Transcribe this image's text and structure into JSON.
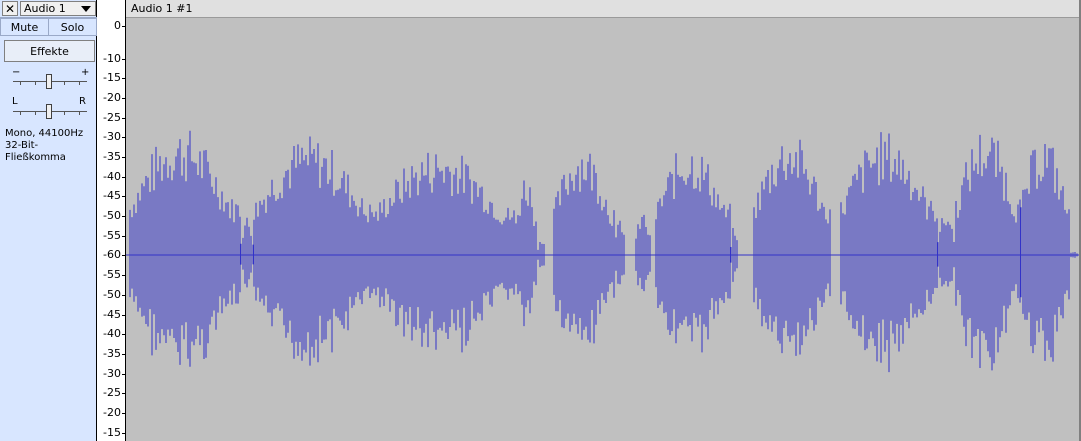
{
  "track": {
    "close_glyph": "✕",
    "name": "Audio 1",
    "mute_label": "Mute",
    "solo_label": "Solo",
    "effects_label": "Effekte",
    "gain_minus": "−",
    "gain_plus": "+",
    "pan_left": "L",
    "pan_right": "R",
    "format_line1": "Mono, 44100Hz",
    "format_line2": "32-Bit-Fließkomma"
  },
  "clip": {
    "name": "Audio 1 #1"
  },
  "ruler": {
    "labels": [
      "0",
      "-10",
      "-15",
      "-20",
      "-25",
      "-30",
      "-35",
      "-40",
      "-45",
      "-50",
      "-55",
      "-60",
      "-55",
      "-50",
      "-45",
      "-40",
      "-35",
      "-30",
      "-25",
      "-20",
      "-15"
    ]
  },
  "colors": {
    "waveform": "#3232c8",
    "rms": "#6464dc",
    "background": "#c0c0c0",
    "panel": "#d8e6ff"
  },
  "icons": {
    "close": "close-icon",
    "dropdown": "triangle-down-icon"
  }
}
